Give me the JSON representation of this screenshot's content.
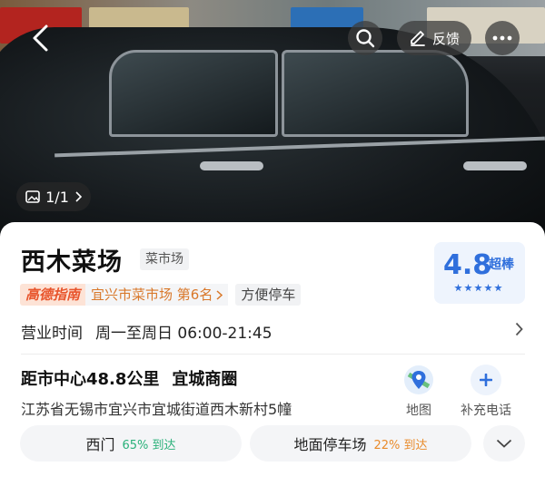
{
  "hero": {
    "photo_counter": "1/1",
    "feedback_label": "反馈",
    "icons": [
      "back-icon",
      "search-icon",
      "feedback-edit-icon",
      "more-icon",
      "image-icon",
      "chevron-right-icon"
    ]
  },
  "place": {
    "name": "西木菜场",
    "category": "菜市场",
    "brand_badge": "高德指南",
    "rank": "宜兴市菜市场 第6名",
    "tag": "方便停车",
    "rating": "4.8",
    "rating_label": "超棒",
    "star_count": 5
  },
  "hours": {
    "label": "营业时间",
    "value": "周一至周日 06:00-21:45"
  },
  "location": {
    "distance": "距市中心48.8公里",
    "district": "宜城商圈",
    "address": "江苏省无锡市宜兴市宜城街道西木新村5幢"
  },
  "actions": {
    "map_label": "地图",
    "phone_label": "补充电话"
  },
  "entrances": [
    {
      "name": "西门",
      "percent": "65% 到达"
    },
    {
      "name": "地面停车场",
      "percent": "22% 到达"
    }
  ],
  "colors": {
    "accent_blue": "#2f6fdc",
    "brand_orange": "#e8542b",
    "green": "#2ab17a",
    "orange": "#e98b2b"
  }
}
